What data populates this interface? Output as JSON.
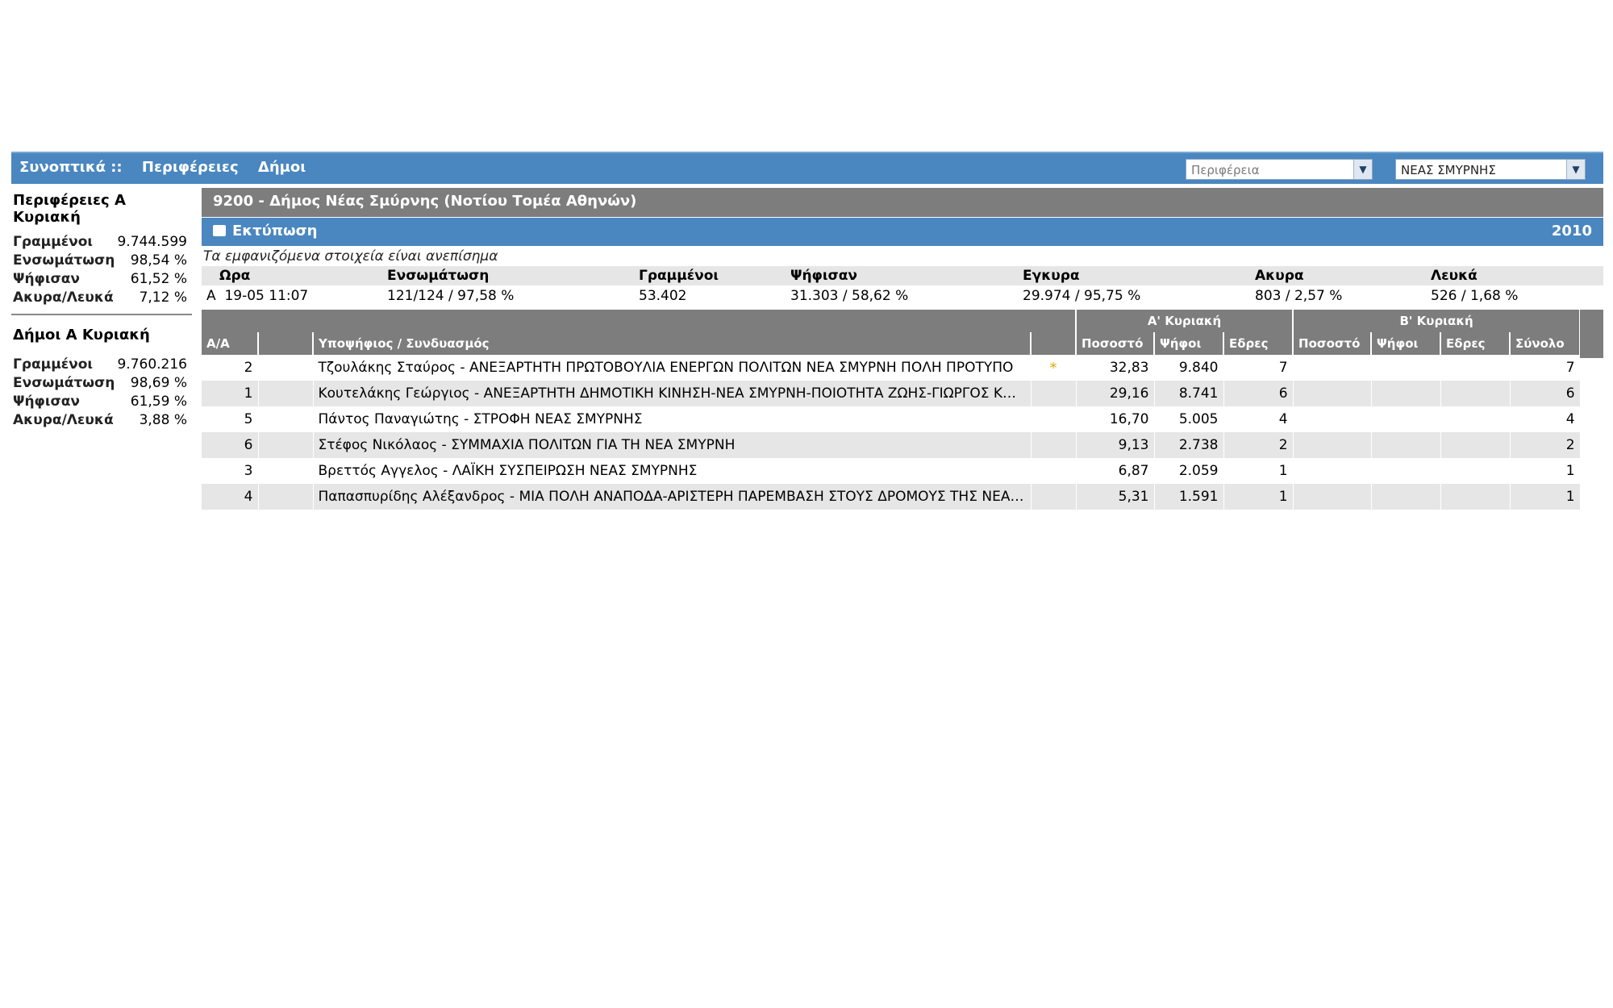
{
  "nav": {
    "links": [
      "Συνοπτικά ::",
      "Περιφέρειες",
      "Δήμοι"
    ]
  },
  "selects": {
    "region_placeholder": "Περιφέρεια",
    "municipality_value": "ΝΕΑΣ ΣΜΥΡΝΗΣ"
  },
  "left": {
    "regions": {
      "title": "Περιφέρειες Α Κυριακή",
      "rows": [
        {
          "k": "Γραμμένοι",
          "v": "9.744.599"
        },
        {
          "k": "Ενσωμάτωση",
          "v": "98,54 %"
        },
        {
          "k": "Ψήφισαν",
          "v": "61,52 %"
        },
        {
          "k": "Ακυρα/Λευκά",
          "v": "7,12 %"
        }
      ]
    },
    "municipalities": {
      "title": "Δήμοι Α Κυριακή",
      "rows": [
        {
          "k": "Γραμμένοι",
          "v": "9.760.216"
        },
        {
          "k": "Ενσωμάτωση",
          "v": "98,69 %"
        },
        {
          "k": "Ψήφισαν",
          "v": "61,59 %"
        },
        {
          "k": "Ακυρα/Λευκά",
          "v": "3,88 %"
        }
      ]
    }
  },
  "main": {
    "title": "9200 - Δήμος Νέας Σμύρνης (Νοτίου Τομέα Αθηνών)",
    "print": "Εκτύπωση",
    "year": "2010",
    "note": "Τα εμφανιζόμενα στοιχεία είναι ανεπίσημα",
    "stats": {
      "headers": [
        "Ωρα",
        "Ενσωμάτωση",
        "Γραμμένοι",
        "Ψήφισαν",
        "Εγκυρα",
        "Ακυρα",
        "Λευκά"
      ],
      "round": "Α",
      "values": [
        "19-05 11:07",
        "121/124 / 97,58 %",
        "53.402",
        "31.303 / 58,62 %",
        "29.974 / 95,75 %",
        "803 / 2,57 %",
        "526 / 1,68 %"
      ]
    },
    "results": {
      "group_a": "Α' Κυριακή",
      "group_b": "Β' Κυριακή",
      "columns": [
        "Α/Α",
        "",
        "Υποψήφιος / Συνδυασμός",
        "",
        "Ποσοστό",
        "Ψήφοι",
        "Εδρες",
        "Ποσοστό",
        "Ψήφοι",
        "Εδρες",
        "Σύνολο"
      ],
      "rows": [
        {
          "aa": "2",
          "cand": "Τζουλάκης Σταύρος - ΑΝΕΞΑΡΤΗΤΗ ΠΡΩΤΟΒΟΥΛΙΑ ΕΝΕΡΓΩΝ ΠΟΛΙΤΩΝ ΝΕΑ ΣΜΥΡΝΗ ΠΟΛΗ ΠΡΟΤΥΠΟ",
          "mark": "*",
          "pct": "32,83",
          "votes": "9.840",
          "seats": "7",
          "total": "7"
        },
        {
          "aa": "1",
          "cand": "Κουτελάκης Γεώργιος - ΑΝΕΞΑΡΤΗΤΗ ΔΗΜΟΤΙΚΗ ΚΙΝΗΣΗ-ΝΕΑ ΣΜΥΡΝΗ-ΠΟΙΟΤΗΤΑ ΖΩΗΣ-ΓΙΩΡΓΟΣ ΚΟΥΤΕΛΑ...",
          "mark": "",
          "pct": "29,16",
          "votes": "8.741",
          "seats": "6",
          "total": "6"
        },
        {
          "aa": "5",
          "cand": "Πάντος Παναγιώτης - ΣΤΡΟΦΗ ΝΕΑΣ ΣΜΥΡΝΗΣ",
          "mark": "",
          "pct": "16,70",
          "votes": "5.005",
          "seats": "4",
          "total": "4"
        },
        {
          "aa": "6",
          "cand": "Στέφος Νικόλαος - ΣΥΜΜΑΧΙΑ ΠΟΛΙΤΩΝ ΓΙΑ ΤΗ ΝΕΑ ΣΜΥΡΝΗ",
          "mark": "",
          "pct": "9,13",
          "votes": "2.738",
          "seats": "2",
          "total": "2"
        },
        {
          "aa": "3",
          "cand": "Βρεττός Αγγελος - ΛΑΪΚΗ ΣΥΣΠΕΙΡΩΣΗ ΝΕΑΣ ΣΜΥΡΝΗΣ",
          "mark": "",
          "pct": "6,87",
          "votes": "2.059",
          "seats": "1",
          "total": "1"
        },
        {
          "aa": "4",
          "cand": "Παπασπυρίδης Αλέξανδρος - ΜΙΑ ΠΟΛΗ ΑΝΑΠΟΔΑ-ΑΡΙΣΤΕΡΗ ΠΑΡΕΜΒΑΣΗ ΣΤΟΥΣ ΔΡΟΜΟΥΣ ΤΗΣ ΝΕΑΣ ΣΜΥ...",
          "mark": "",
          "pct": "5,31",
          "votes": "1.591",
          "seats": "1",
          "total": "1"
        }
      ]
    }
  }
}
